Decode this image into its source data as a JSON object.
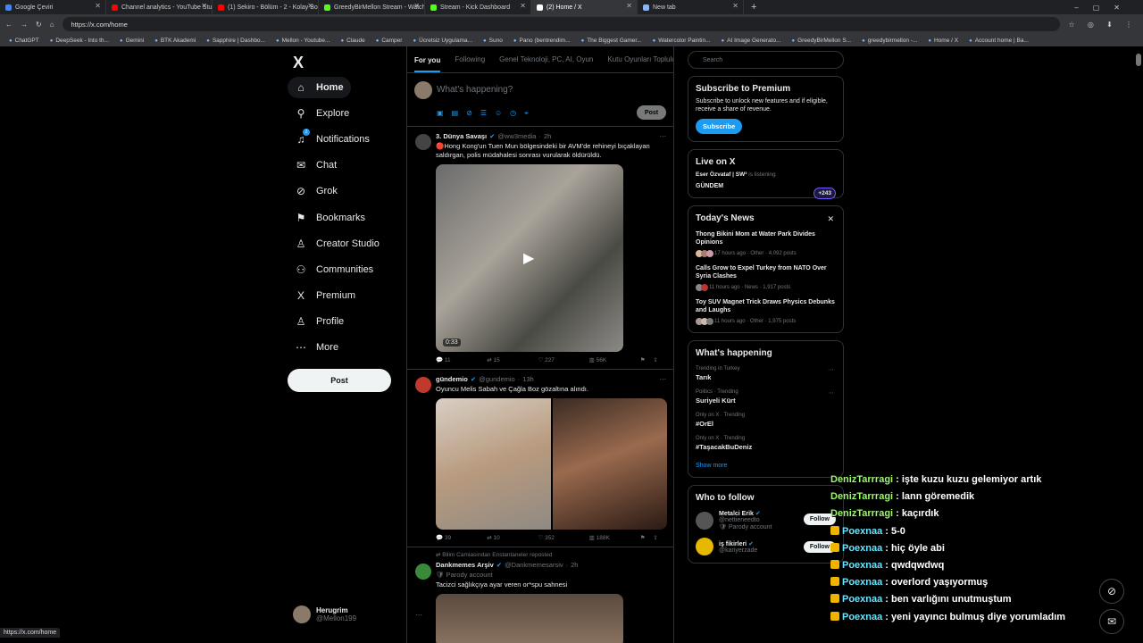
{
  "browser": {
    "tabs": [
      {
        "title": "Google Çeviri",
        "color": "#4285f4",
        "active": false
      },
      {
        "title": "Channel analytics - YouTube Studio",
        "color": "#ff0000",
        "active": false
      },
      {
        "title": "(1) Sekiro - Bölüm - 2 - Kolay Boss",
        "color": "#ff0000",
        "active": false
      },
      {
        "title": "GreedyBirMellon Stream - Watch Live",
        "color": "#53fc18",
        "active": false
      },
      {
        "title": "Stream - Kick Dashboard",
        "color": "#53fc18",
        "active": false
      },
      {
        "title": "(2) Home / X",
        "color": "#ffffff",
        "active": true
      },
      {
        "title": "New tab",
        "color": "#8ab4f8",
        "active": false
      }
    ],
    "url": "https://x.com/home",
    "bookmarks": [
      "ChatGPT",
      "DeepSeek - Into th...",
      "Gemini",
      "BTK Akademi",
      "Sapphire | Dashbo...",
      "Mellon - Youtube...",
      "Claude",
      "Camper",
      "Ücretsiz Uygulama...",
      "Suno",
      "Pano (bentrendim...",
      "The Biggest Gamer...",
      "Watercolor Paintin...",
      "AI Image Generato...",
      "GreedyBirMellon S...",
      "greedybirmellon -...",
      "Home / X",
      "Account home | Ba..."
    ],
    "status_url": "https://x.com/home"
  },
  "nav": {
    "items": [
      {
        "label": "Home",
        "icon": "home-icon",
        "glyph": "⌂"
      },
      {
        "label": "Explore",
        "icon": "search-icon",
        "glyph": "⚲"
      },
      {
        "label": "Notifications",
        "icon": "bell-icon",
        "glyph": "♫"
      },
      {
        "label": "Chat",
        "icon": "mail-icon",
        "glyph": "✉"
      },
      {
        "label": "Grok",
        "icon": "grok-icon",
        "glyph": "⊘"
      },
      {
        "label": "Bookmarks",
        "icon": "bookmark-icon",
        "glyph": "⚑"
      },
      {
        "label": "Creator Studio",
        "icon": "creator-icon",
        "glyph": "♙"
      },
      {
        "label": "Communities",
        "icon": "communities-icon",
        "glyph": "⚇"
      },
      {
        "label": "Premium",
        "icon": "x-icon",
        "glyph": "X"
      },
      {
        "label": "Profile",
        "icon": "profile-icon",
        "glyph": "♙"
      },
      {
        "label": "More",
        "icon": "more-icon",
        "glyph": "⋯"
      }
    ],
    "notif_count": "2",
    "post_label": "Post",
    "user_name": "Herugrim",
    "user_handle": "@Mellon199"
  },
  "feed": {
    "tabs": [
      "For you",
      "Following",
      "Genel Teknoloji, PC, AI, Oyun",
      "Kutu Oyunları Topluluğu"
    ],
    "compose_placeholder": "What's happening?",
    "compose_post": "Post",
    "tweets": [
      {
        "name": "3. Dünya Savaşı",
        "handle": "@ww3media",
        "time": "2h",
        "text": "🔴Hong Kong'un Tuen Mun bölgesindeki bir AVM'de rehineyi bıçaklayan saldırgan, polis müdahalesi sonrası vurularak öldürüldü.",
        "duration": "0:33",
        "replies": "11",
        "reposts": "15",
        "likes": "227",
        "views": "56K"
      },
      {
        "name": "gündemio",
        "handle": "@gundemio",
        "time": "13h",
        "text": "Oyuncu Melis Sabah ve Çağla Boz gözaltına alındı.",
        "replies": "39",
        "reposts": "10",
        "likes": "352",
        "views": "188K"
      },
      {
        "repost_by": "Bilim Camiasından Enstantaneler reposted",
        "name": "Dankmemes Arşiv",
        "handle": "@Dankmemesarsiv",
        "time": "2h",
        "badge": "Parody account",
        "text": "Tacizci sağlıkçıya ayar veren or*spu sahnesi"
      }
    ]
  },
  "sidebar": {
    "search_placeholder": "Search",
    "premium": {
      "title": "Subscribe to Premium",
      "text": "Subscribe to unlock new features and if eligible, receive a share of revenue.",
      "button": "Subscribe"
    },
    "live": {
      "title": "Live on X",
      "host": "Eser Özvataf | SW³",
      "status": "is listening",
      "topic": "GÜNDEM",
      "count": "+243"
    },
    "news": {
      "title": "Today's News",
      "items": [
        {
          "headline": "Thong Bikini Mom at Water Park Divides Opinions",
          "meta": "17 hours ago · Other · 4,092 posts"
        },
        {
          "headline": "Calls Grow to Expel Turkey from NATO Over Syria Clashes",
          "meta": "11 hours ago · News · 1,917 posts"
        },
        {
          "headline": "Toy SUV Magnet Trick Draws Physics Debunks and Laughs",
          "meta": "11 hours ago · Other · 1,975 posts"
        }
      ]
    },
    "happening": {
      "title": "What's happening",
      "trends": [
        {
          "context": "Trending in Turkey",
          "name": "Tarık"
        },
        {
          "context": "Politics · Trending",
          "name": "Suriyeli Kürt"
        },
        {
          "context": "Only on X · Trending",
          "name": "#OrEl"
        },
        {
          "context": "Only on X · Trending",
          "name": "#TaşacakBuDeniz"
        }
      ],
      "show_more": "Show more"
    },
    "who": {
      "title": "Who to follow",
      "users": [
        {
          "name": "Metalci Erik",
          "handle": "@nettieneedto",
          "badge": "Parody account",
          "follow": "Follow"
        },
        {
          "name": "iş fikirleri",
          "handle": "@kariyerzade",
          "follow": "Follow"
        }
      ]
    }
  },
  "chat": [
    {
      "user": "DenizTarrragi",
      "msg": "işte kuzu kuzu gelemiyor artık",
      "badge": false
    },
    {
      "user": "DenizTarrragi",
      "msg": "lann göremedik",
      "badge": false
    },
    {
      "user": "DenizTarrragi",
      "msg": "kaçırdık",
      "badge": false
    },
    {
      "user": "Poexnaa",
      "msg": "5-0",
      "badge": true
    },
    {
      "user": "Poexnaa",
      "msg": "hiç öyle abi",
      "badge": true
    },
    {
      "user": "Poexnaa",
      "msg": "qwdqwdwq",
      "badge": true
    },
    {
      "user": "Poexnaa",
      "msg": "overlord yaşıyormuş",
      "badge": true
    },
    {
      "user": "Poexnaa",
      "msg": "ben varlığını unutmuştum",
      "badge": true
    },
    {
      "user": "Poexnaa",
      "msg": "yeni yayıncı bulmuş diye yorumladım",
      "badge": true
    }
  ]
}
